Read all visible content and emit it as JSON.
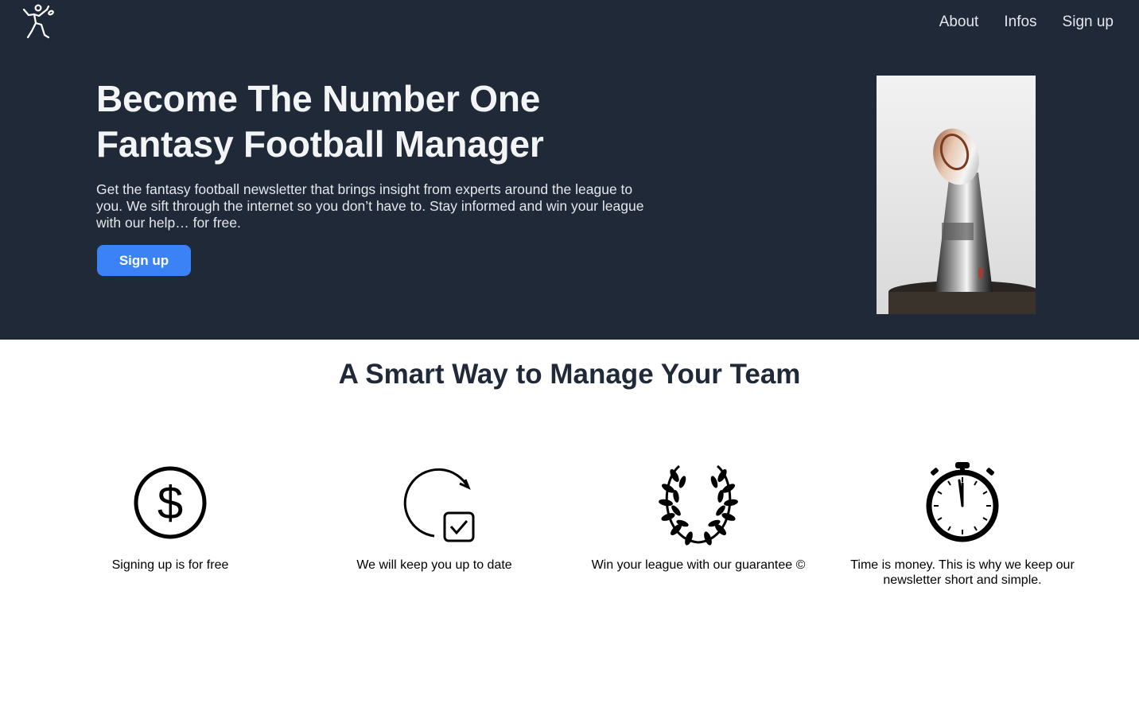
{
  "nav": {
    "logo_icon": "football-player-logo-icon",
    "items": [
      {
        "label": "About"
      },
      {
        "label": "Infos"
      },
      {
        "label": "Sign up"
      }
    ]
  },
  "hero": {
    "title": "Become The Number One Fantasy Football Manager",
    "text": "Get the fantasy football newsletter that brings insight from experts around the league to you. We sift through the internet so you don’t have to. Stay informed and win your league with our help… for free.",
    "button_label": "Sign up",
    "image": "trophy-photo",
    "colors": {
      "background": "#1f2937",
      "button": "#3b82f6"
    }
  },
  "features": {
    "title": "A Smart Way to Manage Your Team",
    "items": [
      {
        "icon": "dollar-circle-icon",
        "text": "Signing up is for free"
      },
      {
        "icon": "refresh-check-icon",
        "text": "We will keep you up to date"
      },
      {
        "icon": "laurel-wreath-icon",
        "text": "Win your league with our guarantee ©"
      },
      {
        "icon": "stopwatch-icon",
        "text": "Time is money. This is why we keep our newsletter short and simple."
      }
    ]
  }
}
